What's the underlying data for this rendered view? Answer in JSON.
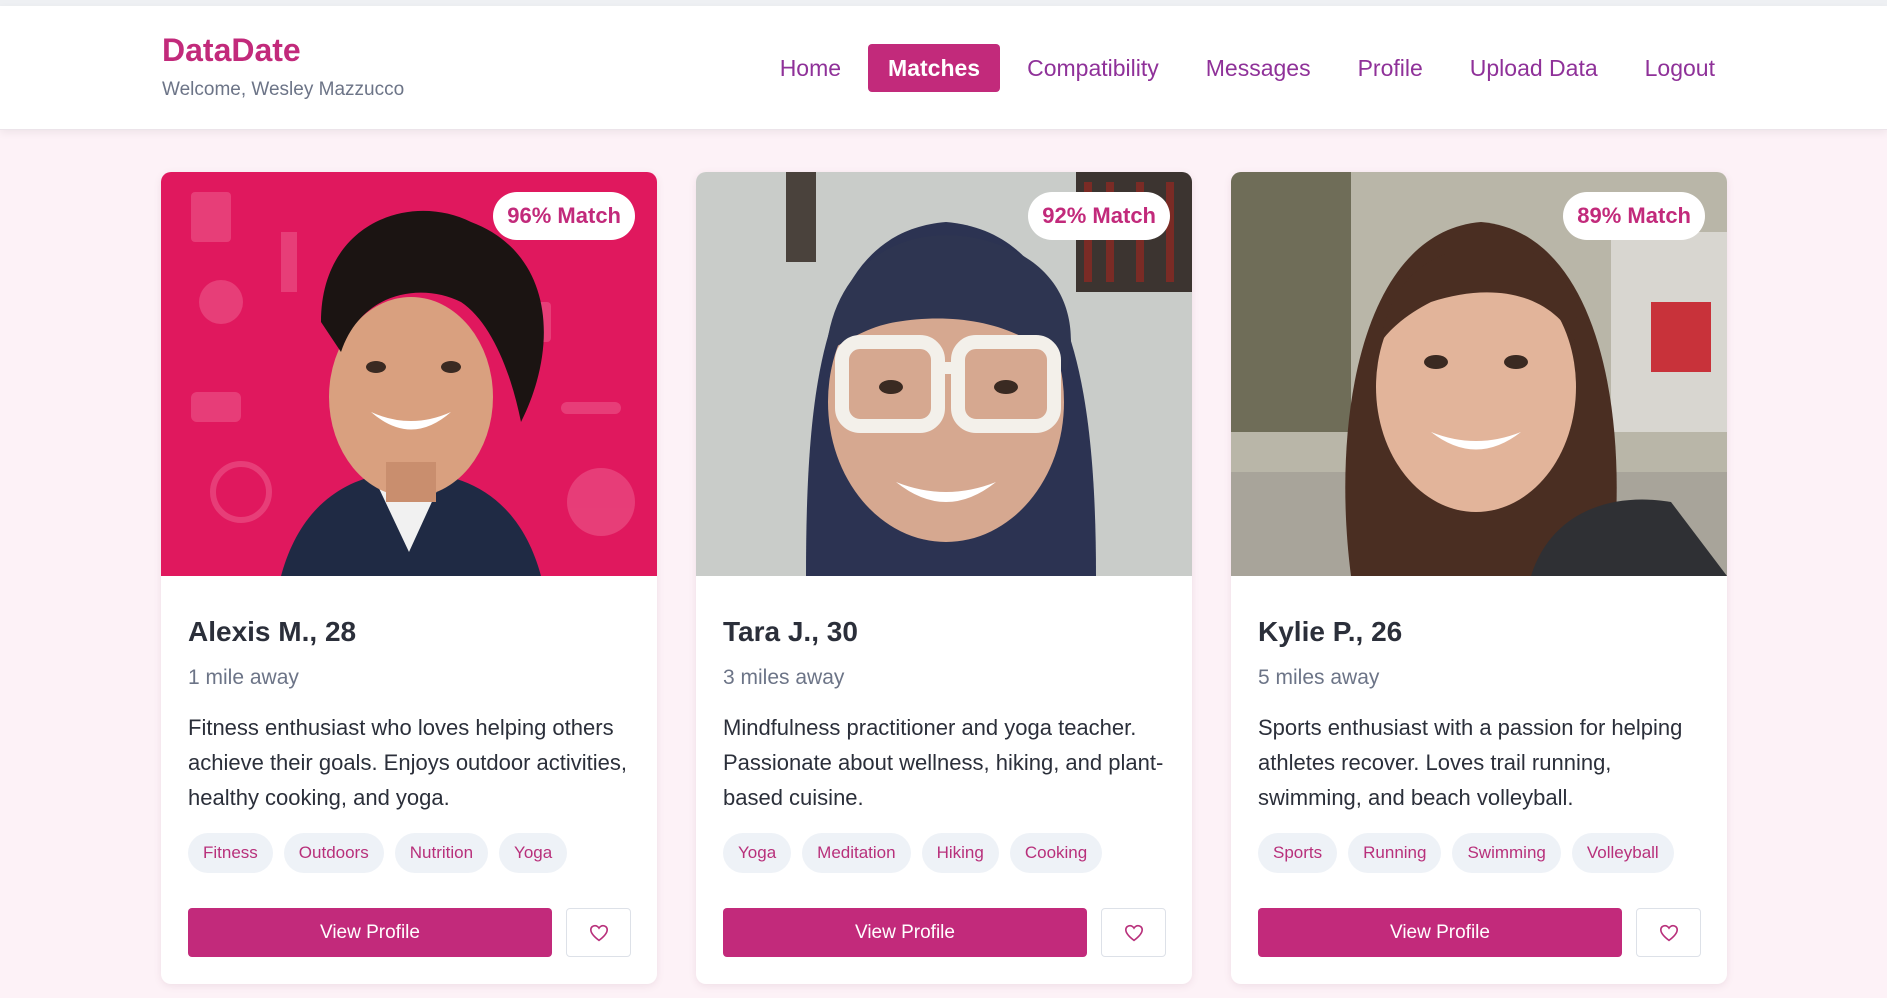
{
  "app": {
    "name": "DataDate",
    "welcome": "Welcome, Wesley Mazzucco"
  },
  "nav": {
    "items": [
      {
        "label": "Home",
        "active": false
      },
      {
        "label": "Matches",
        "active": true
      },
      {
        "label": "Compatibility",
        "active": false
      },
      {
        "label": "Messages",
        "active": false
      },
      {
        "label": "Profile",
        "active": false
      },
      {
        "label": "Upload Data",
        "active": false
      },
      {
        "label": "Logout",
        "active": false
      }
    ]
  },
  "colors": {
    "brand": "#c22a7b",
    "nav_text": "#8f3199",
    "page_bg": "#fdf2f7",
    "tag_bg": "#eef2f7"
  },
  "matches": [
    {
      "match": "96% Match",
      "name": "Alexis M., 28",
      "distance": "1 mile away",
      "bio": "Fitness enthusiast who loves helping others achieve their goals. Enjoys outdoor activities, healthy cooking, and yoga.",
      "tags": [
        "Fitness",
        "Outdoors",
        "Nutrition",
        "Yoga"
      ],
      "view_label": "View Profile",
      "fav_icon": "heart-icon"
    },
    {
      "match": "92% Match",
      "name": "Tara J., 30",
      "distance": "3 miles away",
      "bio": "Mindfulness practitioner and yoga teacher. Passionate about wellness, hiking, and plant-based cuisine.",
      "tags": [
        "Yoga",
        "Meditation",
        "Hiking",
        "Cooking"
      ],
      "view_label": "View Profile",
      "fav_icon": "heart-icon"
    },
    {
      "match": "89% Match",
      "name": "Kylie P., 26",
      "distance": "5 miles away",
      "bio": "Sports enthusiast with a passion for helping athletes recover. Loves trail running, swimming, and beach volleyball.",
      "tags": [
        "Sports",
        "Running",
        "Swimming",
        "Volleyball"
      ],
      "view_label": "View Profile",
      "fav_icon": "heart-icon"
    }
  ]
}
